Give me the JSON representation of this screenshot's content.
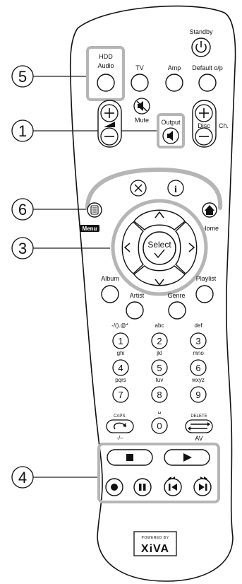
{
  "callouts": {
    "c5": "5",
    "c1": "1",
    "c6": "6",
    "c3": "3",
    "c4": "4"
  },
  "labels": {
    "standby": "Standby",
    "hdd_audio_line1": "HDD",
    "hdd_audio_line2": "Audio",
    "tv": "TV",
    "amp": "Amp",
    "default_op": "Default o/p",
    "mute": "Mute",
    "output": "Output",
    "disc": "Disc",
    "ch": "Ch.",
    "menu": "Menu",
    "home": "Home",
    "select": "Select",
    "album": "Album",
    "playlist": "Playlist",
    "artist": "Artist",
    "genre": "Genre",
    "caps": "CAPS.",
    "delete": "DELETE",
    "dash": "-/–",
    "av": "AV"
  },
  "keypad": [
    {
      "digit": "1",
      "letters": "-/().@*"
    },
    {
      "digit": "2",
      "letters": "abc"
    },
    {
      "digit": "3",
      "letters": "def"
    },
    {
      "digit": "4",
      "letters": "ghi"
    },
    {
      "digit": "5",
      "letters": "jkl"
    },
    {
      "digit": "6",
      "letters": "mno"
    },
    {
      "digit": "7",
      "letters": "pqrs"
    },
    {
      "digit": "8",
      "letters": "tuv"
    },
    {
      "digit": "9",
      "letters": "wxyz"
    },
    {
      "digit": "0",
      "letters": "␣"
    }
  ],
  "logo": {
    "line1": "POWERED BY",
    "line2": "XiVA"
  }
}
